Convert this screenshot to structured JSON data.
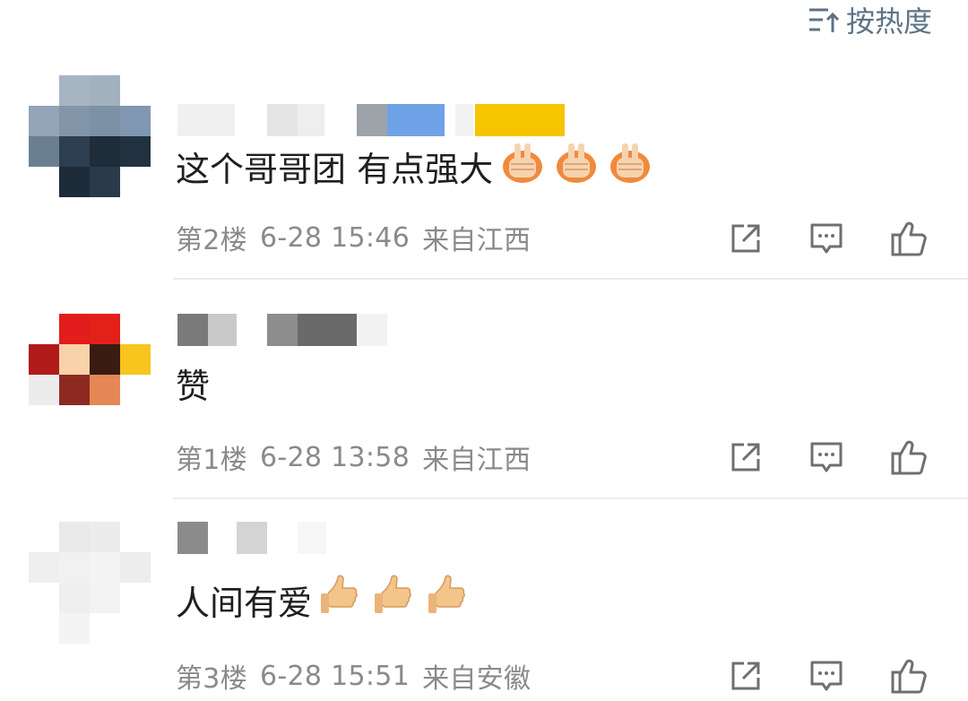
{
  "sort": {
    "label": "按热度",
    "icon": "sort-icon"
  },
  "comments": [
    {
      "text": "这个哥哥团 有点强大",
      "emoji": "praying-hands-emoji",
      "floor": "第2楼",
      "time": "6-28 15:46",
      "location": "来自江西"
    },
    {
      "text": "赞",
      "floor": "第1楼",
      "time": "6-28 13:58",
      "location": "来自江西"
    },
    {
      "text": "人间有爱",
      "emoji": "thumbs-up-emoji",
      "floor": "第3楼",
      "time": "6-28 15:51",
      "location": "来自安徽"
    }
  ],
  "action_icons": [
    "share-icon",
    "reply-icon",
    "like-icon"
  ],
  "colors": {
    "meta_text": "#8a8a8a",
    "icon_stroke": "#6f6f6f",
    "sort_text": "#5d7386"
  }
}
